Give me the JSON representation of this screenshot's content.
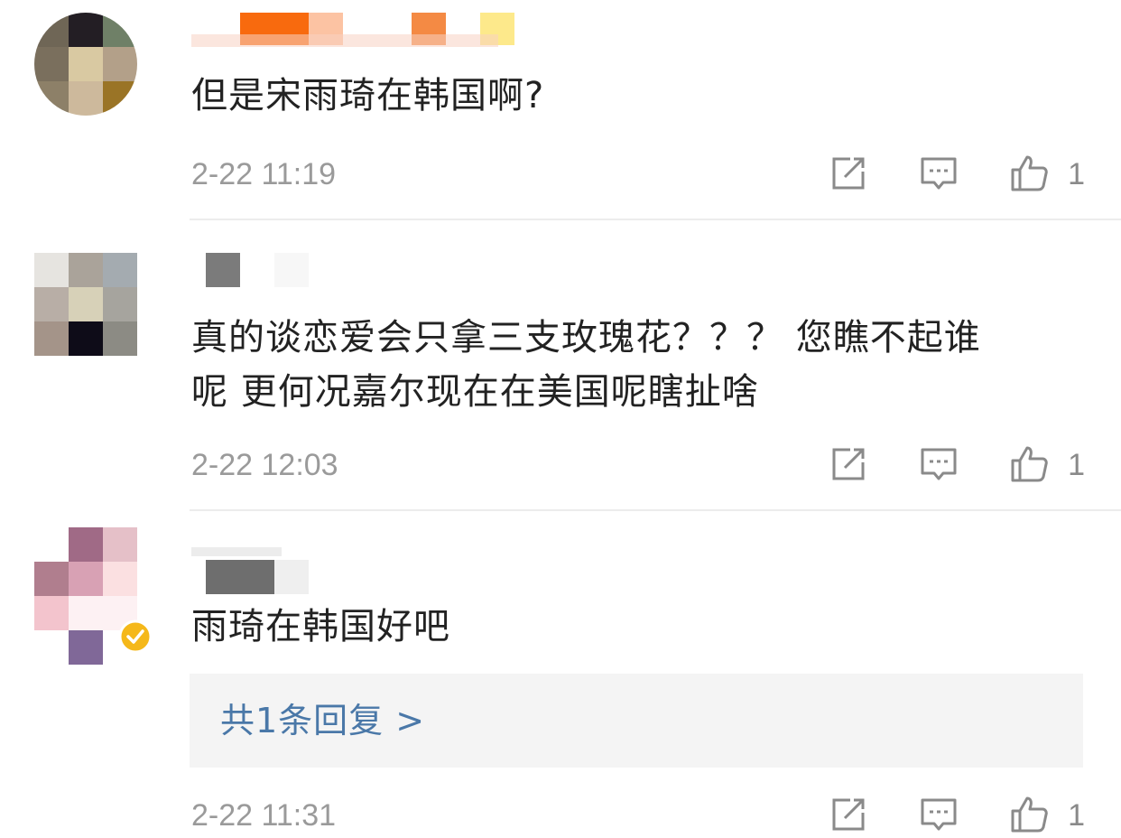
{
  "comments": [
    {
      "text": "但是宋雨琦在韩国啊?",
      "timestamp": "2-22 11:19",
      "like_count": "1"
    },
    {
      "text": "真的谈恋爱会只拿三支玫瑰花？？？ 您瞧不起谁\n呢 更何况嘉尔现在在美国呢瞎扯啥",
      "timestamp": "2-22 12:03",
      "like_count": "1"
    },
    {
      "text": "雨琦在韩国好吧",
      "timestamp": "2-22 11:31",
      "like_count": "1",
      "reply_link": "共1条回复 >"
    }
  ],
  "icons": {
    "share": "share-icon",
    "comment": "comment-icon",
    "like": "thumbs-up-icon",
    "verified": "verified-badge-icon"
  },
  "colors": {
    "text": "#222222",
    "meta": "#9a9a9a",
    "link": "#4a78a8",
    "divider": "#ececec",
    "reply_bg": "#f4f4f4",
    "verified": "#f5b81a"
  }
}
